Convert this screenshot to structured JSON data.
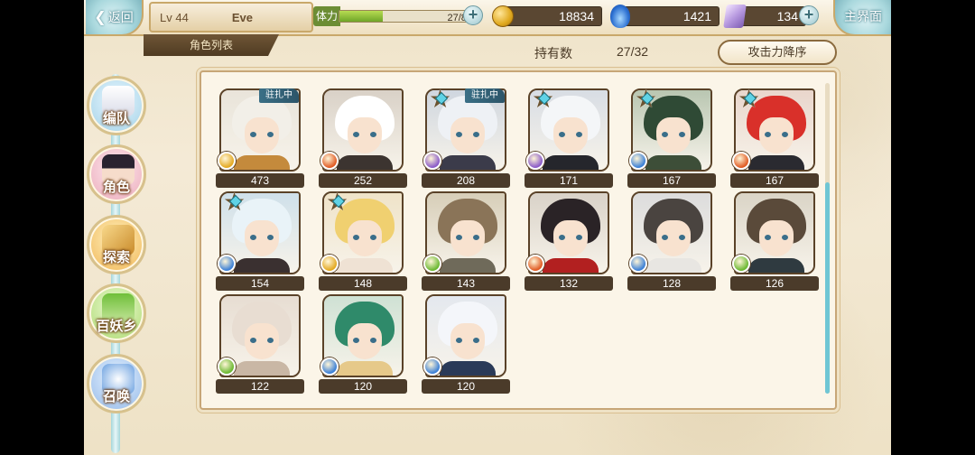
{
  "nav": {
    "back_label": "返回",
    "home_label": "主界面"
  },
  "player": {
    "level": "Lv 44",
    "name": "Eve"
  },
  "resources": {
    "stamina_label": "体力",
    "stamina_text": "27/83",
    "stamina_fraction": 0.325,
    "gold": "18834",
    "souls": "1421",
    "gems": "134"
  },
  "header": {
    "section_title": "角色列表",
    "owned_label": "持有数",
    "owned_count": "27/32",
    "sort_label": "攻击力降序"
  },
  "sidebar": {
    "items": [
      {
        "label": "编队"
      },
      {
        "label": "角色"
      },
      {
        "label": "探索"
      },
      {
        "label": "百妖乡"
      },
      {
        "label": "召唤"
      }
    ]
  },
  "characters": [
    {
      "power": "473",
      "badge": "驻扎中",
      "element_color": "#e3a820",
      "star": false
    },
    {
      "power": "252",
      "badge": "",
      "element_color": "#e05a22",
      "star": false
    },
    {
      "power": "208",
      "badge": "驻扎中",
      "element_color": "#8a5ac8",
      "star": true
    },
    {
      "power": "171",
      "badge": "",
      "element_color": "#8a5ac8",
      "star": true
    },
    {
      "power": "167",
      "badge": "",
      "element_color": "#3a7fd6",
      "star": true
    },
    {
      "power": "167",
      "badge": "",
      "element_color": "#e05a22",
      "star": true
    },
    {
      "power": "154",
      "badge": "",
      "element_color": "#3a7fd6",
      "star": true
    },
    {
      "power": "148",
      "badge": "",
      "element_color": "#e3a820",
      "star": true
    },
    {
      "power": "143",
      "badge": "",
      "element_color": "#6ab830",
      "star": false
    },
    {
      "power": "132",
      "badge": "",
      "element_color": "#e05a22",
      "star": false
    },
    {
      "power": "128",
      "badge": "",
      "element_color": "#3a7fd6",
      "star": false
    },
    {
      "power": "126",
      "badge": "",
      "element_color": "#6ab830",
      "star": false
    },
    {
      "power": "122",
      "badge": "",
      "element_color": "#6ab830",
      "star": false
    },
    {
      "power": "120",
      "badge": "",
      "element_color": "#3a7fd6",
      "star": false
    },
    {
      "power": "120",
      "badge": "",
      "element_color": "#3a7fd6",
      "star": false
    }
  ]
}
